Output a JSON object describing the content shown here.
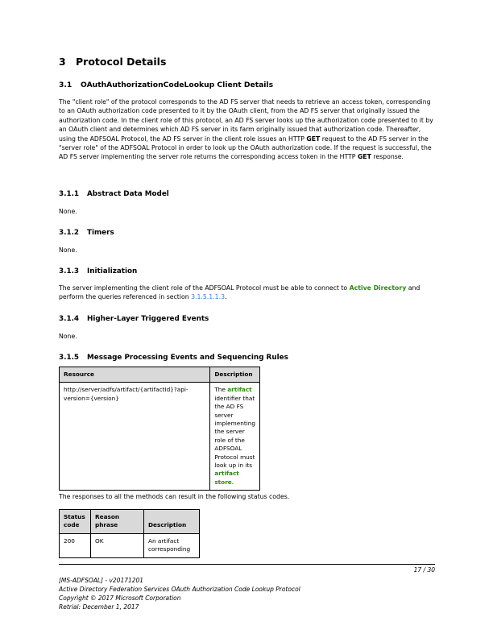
{
  "heading": {
    "num": "3",
    "title": "Protocol Details"
  },
  "section_3_1": {
    "num": "3.1",
    "title": "OAuthAuthorizationCodeLookup Client Details",
    "para_a": "The \"client role\" of the protocol corresponds to the AD FS server that needs to retrieve an access token, corresponding to an OAuth authorization code presented to it by the OAuth client, from the AD FS server that originally issued the authorization code. In the client role of this protocol, an AD FS server looks up the authorization code presented to it by an OAuth client and determines which AD FS server in its farm originally issued that authorization code. Thereafter, using the ADFSOAL Protocol, the AD FS server in the client role issues an HTTP ",
    "para_get1": "GET",
    "para_b": " request to the AD FS server in the \"server role\" of the ADFSOAL Protocol in order to look up the OAuth authorization code. If the request is successful, the AD FS server implementing the server role returns the corresponding access token in the HTTP ",
    "para_get2": "GET",
    "para_c": " response."
  },
  "s311": {
    "num": "3.1.1",
    "title": "Abstract Data Model",
    "body": "None."
  },
  "s312": {
    "num": "3.1.2",
    "title": "Timers",
    "body": "None."
  },
  "s313": {
    "num": "3.1.3",
    "title": "Initialization",
    "body_a": "The server implementing the client role of the ADFSOAL Protocol must be able to connect to ",
    "link_ad": "Active Directory",
    "body_b": " and perform the queries referenced in section ",
    "link_section": "3.1.5.1.1.3",
    "body_c": "."
  },
  "s314": {
    "num": "3.1.4",
    "title": "Higher-Layer Triggered Events",
    "body": "None."
  },
  "s315": {
    "num": "3.1.5",
    "title": "Message Processing Events and Sequencing Rules",
    "resource_table": {
      "headers": [
        "Resource",
        "Description"
      ],
      "row": {
        "resource": "http://server/adfs/artifact/{artifactId}?api-version={version}",
        "desc_a": "The ",
        "desc_term1": "artifact",
        "desc_b": " identifier that the AD FS server implementing the server role of the ADFSOAL Protocol must look up in its ",
        "desc_term2": "artifact store",
        "desc_c": "."
      }
    },
    "responses_intro": "The responses to all the methods can result in the following status codes.",
    "status_table": {
      "headers": [
        "Status code",
        "Reason phrase",
        "Description"
      ],
      "rows": [
        [
          "200",
          "OK",
          "An artifact corresponding"
        ]
      ]
    }
  },
  "footer": {
    "page": "17 / 30",
    "lines": [
      "[MS-ADFSOAL] - v20171201",
      "Active Directory Federation Services OAuth Authorization Code Lookup Protocol",
      "Copyright © 2017 Microsoft Corporation",
      "Retrial: December 1, 2017"
    ]
  },
  "colors": {
    "glossary_term": "#2a8a0c",
    "link": "#3c7fc9",
    "table_header_bg": "#d9d9d9"
  }
}
